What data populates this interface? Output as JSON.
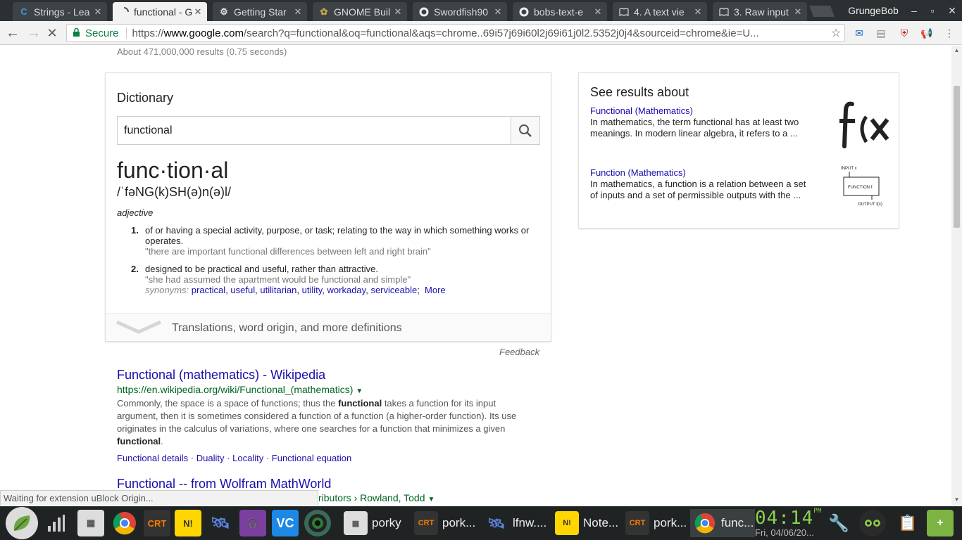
{
  "tabs": [
    {
      "title": "Strings - Lea",
      "icon": "c-logo-icon"
    },
    {
      "title": "functional - G",
      "icon": "loading-spinner-icon"
    },
    {
      "title": "Getting Star",
      "icon": "gear-icon"
    },
    {
      "title": "GNOME Buil",
      "icon": "gnome-builder-icon"
    },
    {
      "title": "Swordfish90",
      "icon": "github-icon"
    },
    {
      "title": "bobs-text-e",
      "icon": "github-icon"
    },
    {
      "title": "4. A text vie",
      "icon": "book-icon"
    },
    {
      "title": "3. Raw input",
      "icon": "book-icon"
    }
  ],
  "profile": "GrungeBob",
  "omnibox": {
    "secure_label": "Secure",
    "scheme": "https://",
    "host": "www.google.com",
    "path": "/search?q=functional&oq=functional&aqs=chrome..69i57j69i60l2j69i61j0l2.5352j0j4&sourceid=chrome&ie=U..."
  },
  "results_count": "About 471,000,000 results (0.75 seconds)",
  "dictionary": {
    "label": "Dictionary",
    "search_value": "functional",
    "word": "func·tion·al",
    "pronunciation": "/ˈfəNG(k)SH(ə)n(ə)l/",
    "pos": "adjective",
    "definitions": [
      {
        "num": "1.",
        "text": "of or having a special activity, purpose, or task; relating to the way in which something works or operates.",
        "example": "\"there are important functional differences between left and right brain\""
      },
      {
        "num": "2.",
        "text": "designed to be practical and useful, rather than attractive.",
        "example": "\"she had assumed the apartment would be functional and simple\""
      }
    ],
    "synonyms_label": "synonyms:",
    "synonyms": [
      "practical",
      "useful",
      "utilitarian",
      "utility",
      "workaday",
      "serviceable"
    ],
    "more": "More",
    "translations": "Translations, word origin, and more definitions",
    "feedback": "Feedback"
  },
  "knowledge_panel": {
    "heading": "See results about",
    "items": [
      {
        "title": "Functional (Mathematics)",
        "desc": "In mathematics, the term functional has at least two meanings. In modern linear algebra, it refers to a ..."
      },
      {
        "title": "Function (Mathematics)",
        "desc": "In mathematics, a function is a relation between a set of inputs and a set of permissible outputs with the ...",
        "diagram": {
          "input": "INPUT x",
          "box": "FUNCTION f:",
          "output": "OUTPUT f(x)"
        }
      }
    ]
  },
  "results": [
    {
      "title": "Functional (mathematics) - Wikipedia",
      "url": "https://en.wikipedia.org/wiki/Functional_(mathematics)",
      "snippet_parts": [
        "Commonly, the space is a space of functions; thus the ",
        "functional",
        " takes a function for its input argument, then it is sometimes considered a function of a function (a higher-order function). Its use originates in the calculus of variations, where one searches for a function that minimizes a given ",
        "functional",
        "."
      ],
      "links": [
        "Functional details",
        "Duality",
        "Locality",
        "Functional equation"
      ]
    },
    {
      "title": "Functional -- from Wolfram MathWorld",
      "breadcrumb": "ributors › Rowland, Todd"
    }
  ],
  "status_text": "Waiting for extension uBlock Origin...",
  "taskbar": {
    "tasks": [
      {
        "label": "porky",
        "icon": "files-icon"
      },
      {
        "label": "pork...",
        "icon": "crt-icon"
      },
      {
        "label": "lfnw....",
        "icon": "satellite-icon"
      },
      {
        "label": "Note...",
        "icon": "notes-icon"
      },
      {
        "label": "pork...",
        "icon": "crt-icon"
      },
      {
        "label": "func...",
        "icon": "chrome-icon"
      }
    ],
    "time": "04:14",
    "ampm": "PM",
    "date": "Fri, 04/06/20..."
  },
  "colors": {
    "link": "#1a0dab",
    "url_green": "#006621",
    "clock_green": "#8ad34a",
    "tabstrip": "#2b3033"
  }
}
